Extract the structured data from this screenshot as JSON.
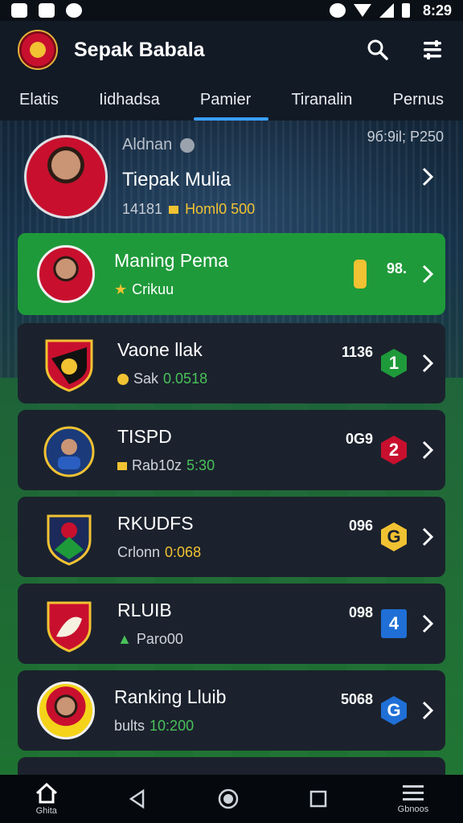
{
  "status_bar": {
    "time": "8:29"
  },
  "header": {
    "title": "Sepak Babala"
  },
  "tabs": [
    {
      "label": "Elatis"
    },
    {
      "label": "Iidhadsa"
    },
    {
      "label": "Pamier",
      "active": true
    },
    {
      "label": "Tiranalin"
    },
    {
      "label": "Pernus"
    }
  ],
  "featured": {
    "label": "Aldnan",
    "right_value": "9б:9il; P250",
    "name": "Tiepak Mulia",
    "stat": "14181",
    "tag": "Homl0 500"
  },
  "rows": [
    {
      "name": "Maning Pema",
      "sub": "Crikuu",
      "score": "98.",
      "highlight": true
    },
    {
      "name": "Vaone llak",
      "sub_label": "Sak",
      "sub_value": "0.0518",
      "score": "1136",
      "rank": "1"
    },
    {
      "name": "TISPD",
      "sub_label": "Rab10z",
      "sub_value": "5:30",
      "score": "0G9",
      "rank": "2"
    },
    {
      "name": "RKUDFS",
      "sub_label": "Crlonn",
      "sub_value": "0:068",
      "score": "096",
      "rank": "G"
    },
    {
      "name": "RLUIB",
      "sub_label": "Paro00",
      "sub_value": "",
      "score": "098",
      "rank": "4"
    },
    {
      "name": "Ranking Lluib",
      "sub_label": "bults",
      "sub_value": "10:200",
      "score": "5068",
      "rank": "G"
    }
  ],
  "nav": {
    "home_label": "Ghita",
    "menu_label": "Gbnoos"
  },
  "colors": {
    "accent": "#3aa0ff",
    "green": "#1f9a3a",
    "card": "#1b222d",
    "gold": "#f1c232"
  }
}
